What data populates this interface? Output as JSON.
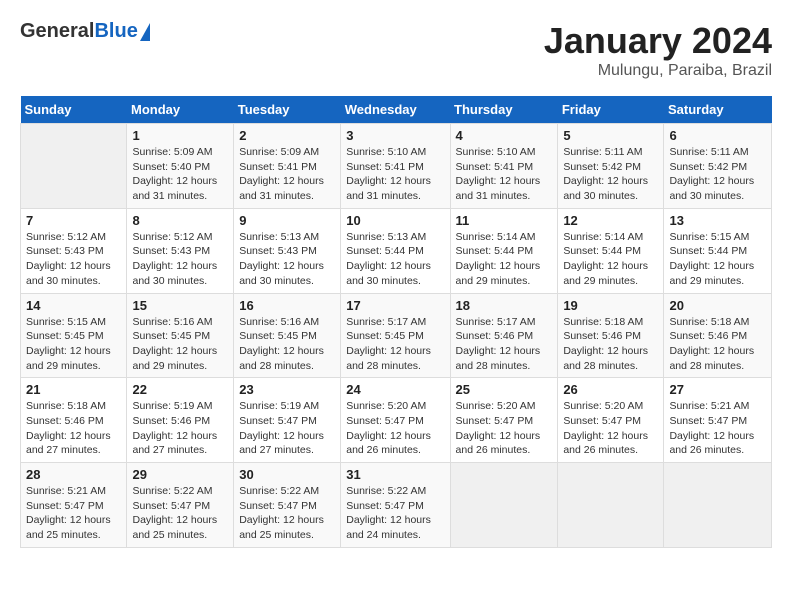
{
  "header": {
    "logo_general": "General",
    "logo_blue": "Blue",
    "month_title": "January 2024",
    "location": "Mulungu, Paraiba, Brazil"
  },
  "days_of_week": [
    "Sunday",
    "Monday",
    "Tuesday",
    "Wednesday",
    "Thursday",
    "Friday",
    "Saturday"
  ],
  "weeks": [
    [
      {
        "day": "",
        "sunrise": "",
        "sunset": "",
        "daylight": ""
      },
      {
        "day": "1",
        "sunrise": "Sunrise: 5:09 AM",
        "sunset": "Sunset: 5:40 PM",
        "daylight": "Daylight: 12 hours and 31 minutes."
      },
      {
        "day": "2",
        "sunrise": "Sunrise: 5:09 AM",
        "sunset": "Sunset: 5:41 PM",
        "daylight": "Daylight: 12 hours and 31 minutes."
      },
      {
        "day": "3",
        "sunrise": "Sunrise: 5:10 AM",
        "sunset": "Sunset: 5:41 PM",
        "daylight": "Daylight: 12 hours and 31 minutes."
      },
      {
        "day": "4",
        "sunrise": "Sunrise: 5:10 AM",
        "sunset": "Sunset: 5:41 PM",
        "daylight": "Daylight: 12 hours and 31 minutes."
      },
      {
        "day": "5",
        "sunrise": "Sunrise: 5:11 AM",
        "sunset": "Sunset: 5:42 PM",
        "daylight": "Daylight: 12 hours and 30 minutes."
      },
      {
        "day": "6",
        "sunrise": "Sunrise: 5:11 AM",
        "sunset": "Sunset: 5:42 PM",
        "daylight": "Daylight: 12 hours and 30 minutes."
      }
    ],
    [
      {
        "day": "7",
        "sunrise": "Sunrise: 5:12 AM",
        "sunset": "Sunset: 5:43 PM",
        "daylight": "Daylight: 12 hours and 30 minutes."
      },
      {
        "day": "8",
        "sunrise": "Sunrise: 5:12 AM",
        "sunset": "Sunset: 5:43 PM",
        "daylight": "Daylight: 12 hours and 30 minutes."
      },
      {
        "day": "9",
        "sunrise": "Sunrise: 5:13 AM",
        "sunset": "Sunset: 5:43 PM",
        "daylight": "Daylight: 12 hours and 30 minutes."
      },
      {
        "day": "10",
        "sunrise": "Sunrise: 5:13 AM",
        "sunset": "Sunset: 5:44 PM",
        "daylight": "Daylight: 12 hours and 30 minutes."
      },
      {
        "day": "11",
        "sunrise": "Sunrise: 5:14 AM",
        "sunset": "Sunset: 5:44 PM",
        "daylight": "Daylight: 12 hours and 29 minutes."
      },
      {
        "day": "12",
        "sunrise": "Sunrise: 5:14 AM",
        "sunset": "Sunset: 5:44 PM",
        "daylight": "Daylight: 12 hours and 29 minutes."
      },
      {
        "day": "13",
        "sunrise": "Sunrise: 5:15 AM",
        "sunset": "Sunset: 5:44 PM",
        "daylight": "Daylight: 12 hours and 29 minutes."
      }
    ],
    [
      {
        "day": "14",
        "sunrise": "Sunrise: 5:15 AM",
        "sunset": "Sunset: 5:45 PM",
        "daylight": "Daylight: 12 hours and 29 minutes."
      },
      {
        "day": "15",
        "sunrise": "Sunrise: 5:16 AM",
        "sunset": "Sunset: 5:45 PM",
        "daylight": "Daylight: 12 hours and 29 minutes."
      },
      {
        "day": "16",
        "sunrise": "Sunrise: 5:16 AM",
        "sunset": "Sunset: 5:45 PM",
        "daylight": "Daylight: 12 hours and 28 minutes."
      },
      {
        "day": "17",
        "sunrise": "Sunrise: 5:17 AM",
        "sunset": "Sunset: 5:45 PM",
        "daylight": "Daylight: 12 hours and 28 minutes."
      },
      {
        "day": "18",
        "sunrise": "Sunrise: 5:17 AM",
        "sunset": "Sunset: 5:46 PM",
        "daylight": "Daylight: 12 hours and 28 minutes."
      },
      {
        "day": "19",
        "sunrise": "Sunrise: 5:18 AM",
        "sunset": "Sunset: 5:46 PM",
        "daylight": "Daylight: 12 hours and 28 minutes."
      },
      {
        "day": "20",
        "sunrise": "Sunrise: 5:18 AM",
        "sunset": "Sunset: 5:46 PM",
        "daylight": "Daylight: 12 hours and 28 minutes."
      }
    ],
    [
      {
        "day": "21",
        "sunrise": "Sunrise: 5:18 AM",
        "sunset": "Sunset: 5:46 PM",
        "daylight": "Daylight: 12 hours and 27 minutes."
      },
      {
        "day": "22",
        "sunrise": "Sunrise: 5:19 AM",
        "sunset": "Sunset: 5:46 PM",
        "daylight": "Daylight: 12 hours and 27 minutes."
      },
      {
        "day": "23",
        "sunrise": "Sunrise: 5:19 AM",
        "sunset": "Sunset: 5:47 PM",
        "daylight": "Daylight: 12 hours and 27 minutes."
      },
      {
        "day": "24",
        "sunrise": "Sunrise: 5:20 AM",
        "sunset": "Sunset: 5:47 PM",
        "daylight": "Daylight: 12 hours and 26 minutes."
      },
      {
        "day": "25",
        "sunrise": "Sunrise: 5:20 AM",
        "sunset": "Sunset: 5:47 PM",
        "daylight": "Daylight: 12 hours and 26 minutes."
      },
      {
        "day": "26",
        "sunrise": "Sunrise: 5:20 AM",
        "sunset": "Sunset: 5:47 PM",
        "daylight": "Daylight: 12 hours and 26 minutes."
      },
      {
        "day": "27",
        "sunrise": "Sunrise: 5:21 AM",
        "sunset": "Sunset: 5:47 PM",
        "daylight": "Daylight: 12 hours and 26 minutes."
      }
    ],
    [
      {
        "day": "28",
        "sunrise": "Sunrise: 5:21 AM",
        "sunset": "Sunset: 5:47 PM",
        "daylight": "Daylight: 12 hours and 25 minutes."
      },
      {
        "day": "29",
        "sunrise": "Sunrise: 5:22 AM",
        "sunset": "Sunset: 5:47 PM",
        "daylight": "Daylight: 12 hours and 25 minutes."
      },
      {
        "day": "30",
        "sunrise": "Sunrise: 5:22 AM",
        "sunset": "Sunset: 5:47 PM",
        "daylight": "Daylight: 12 hours and 25 minutes."
      },
      {
        "day": "31",
        "sunrise": "Sunrise: 5:22 AM",
        "sunset": "Sunset: 5:47 PM",
        "daylight": "Daylight: 12 hours and 24 minutes."
      },
      {
        "day": "",
        "sunrise": "",
        "sunset": "",
        "daylight": ""
      },
      {
        "day": "",
        "sunrise": "",
        "sunset": "",
        "daylight": ""
      },
      {
        "day": "",
        "sunrise": "",
        "sunset": "",
        "daylight": ""
      }
    ]
  ]
}
